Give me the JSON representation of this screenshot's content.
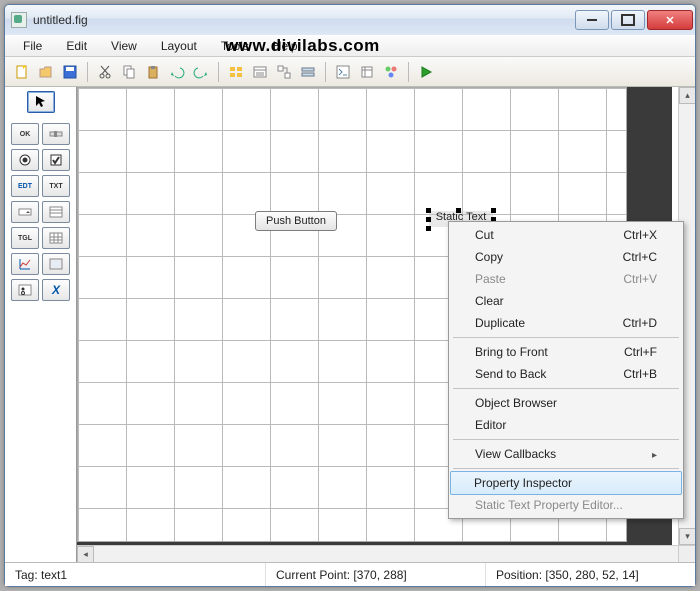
{
  "window": {
    "title": "untitled.fig"
  },
  "menu": {
    "file": "File",
    "edit": "Edit",
    "view": "View",
    "layout": "Layout",
    "tools": "Tools",
    "help": "Help"
  },
  "watermark": "www.divilabs.com",
  "canvas": {
    "pushbutton_label": "Push Button",
    "statictext_label": "Static Text"
  },
  "context_menu": {
    "cut": {
      "label": "Cut",
      "accel": "Ctrl+X"
    },
    "copy": {
      "label": "Copy",
      "accel": "Ctrl+C"
    },
    "paste": {
      "label": "Paste",
      "accel": "Ctrl+V"
    },
    "clear": {
      "label": "Clear"
    },
    "duplicate": {
      "label": "Duplicate",
      "accel": "Ctrl+D"
    },
    "bring_front": {
      "label": "Bring to Front",
      "accel": "Ctrl+F"
    },
    "send_back": {
      "label": "Send to Back",
      "accel": "Ctrl+B"
    },
    "object_browser": {
      "label": "Object Browser"
    },
    "editor": {
      "label": "Editor"
    },
    "view_callbacks": {
      "label": "View Callbacks"
    },
    "property_inspector": {
      "label": "Property Inspector"
    },
    "static_text_editor": {
      "label": "Static Text Property Editor..."
    }
  },
  "status": {
    "tag": "Tag: text1",
    "current_point": "Current Point:   [370, 288]",
    "position": "Position: [350, 280, 52, 14]"
  }
}
